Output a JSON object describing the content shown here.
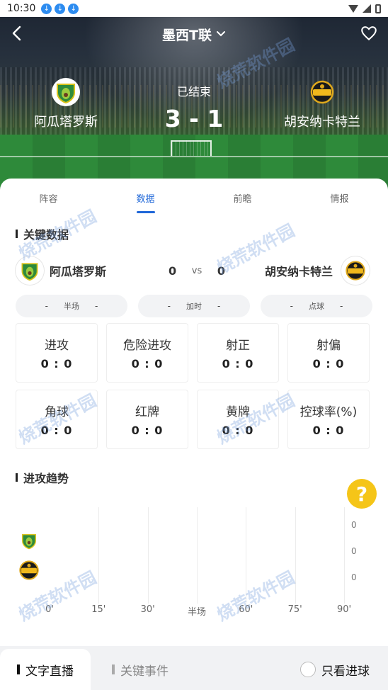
{
  "status_bar": {
    "time": "10:30"
  },
  "header": {
    "league": "墨西T联",
    "match_status": "已结束",
    "home_team": "阿瓜塔罗斯",
    "away_team": "胡安纳卡特兰",
    "score": "3 - 1"
  },
  "tabs": [
    {
      "label": "阵容"
    },
    {
      "label": "数据",
      "active": true
    },
    {
      "label": "前瞻"
    },
    {
      "label": "情报"
    }
  ],
  "key_data": {
    "title": "关键数据",
    "home_name": "阿瓜塔罗斯",
    "away_name": "胡安纳卡特兰",
    "home_score": "0",
    "away_score": "0",
    "vs": "vs",
    "pills": [
      {
        "left": "-",
        "label": "半场",
        "right": "-"
      },
      {
        "left": "-",
        "label": "加时",
        "right": "-"
      },
      {
        "left": "-",
        "label": "点球",
        "right": "-"
      }
    ],
    "stats": [
      {
        "label": "进攻",
        "value": "0 : 0"
      },
      {
        "label": "危险进攻",
        "value": "0 : 0"
      },
      {
        "label": "射正",
        "value": "0 : 0"
      },
      {
        "label": "射偏",
        "value": "0 : 0"
      },
      {
        "label": "角球",
        "value": "0 : 0"
      },
      {
        "label": "红牌",
        "value": "0 : 0"
      },
      {
        "label": "黄牌",
        "value": "0 : 0"
      },
      {
        "label": "控球率(%)",
        "value": "0 : 0"
      }
    ]
  },
  "attack_trend": {
    "title": "进攻趋势",
    "help_symbol": "?"
  },
  "chart_data": {
    "type": "bar",
    "categories": [
      "0'",
      "15'",
      "30'",
      "半场",
      "60'",
      "75'",
      "90'"
    ],
    "y_tick_labels": [
      "0",
      "0",
      "0"
    ],
    "series": []
  },
  "bottom_bar": {
    "live_label": "文字直播",
    "events_label": "关键事件",
    "only_goals_label": "只看进球"
  },
  "watermark": "烧荒软件园",
  "colors": {
    "accent": "#1f67d8",
    "help": "#f5c518"
  }
}
